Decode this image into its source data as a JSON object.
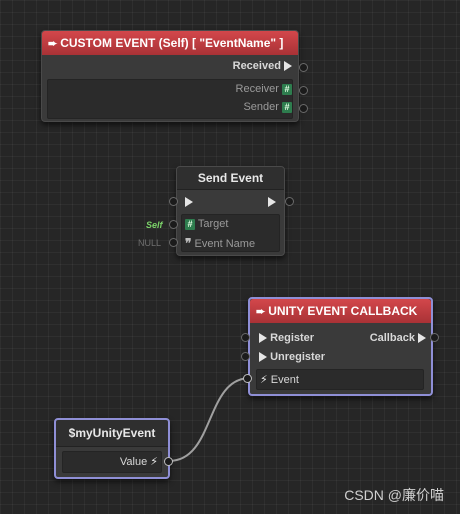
{
  "custom_event_node": {
    "title": "CUSTOM EVENT (Self) [ \"EventName\" ]",
    "received_label": "Received",
    "receiver_label": "Receiver",
    "sender_label": "Sender"
  },
  "send_event_node": {
    "title": "Send Event",
    "target_label": "Target",
    "target_value": "Self",
    "event_name_label": "Event Name",
    "event_name_value": "NULL"
  },
  "unity_event_callback_node": {
    "title": "UNITY EVENT CALLBACK",
    "register_label": "Register",
    "unregister_label": "Unregister",
    "callback_label": "Callback",
    "event_label": "Event"
  },
  "my_unity_event_node": {
    "title": "$myUnityEvent",
    "value_label": "Value"
  },
  "watermark": "CSDN @廉价喵",
  "colors": {
    "header_red": "#c43e42",
    "selection_outline": "#8f8fd6",
    "self_label_green": "#7cd36a",
    "connection_wire": "#a0a0a0"
  }
}
